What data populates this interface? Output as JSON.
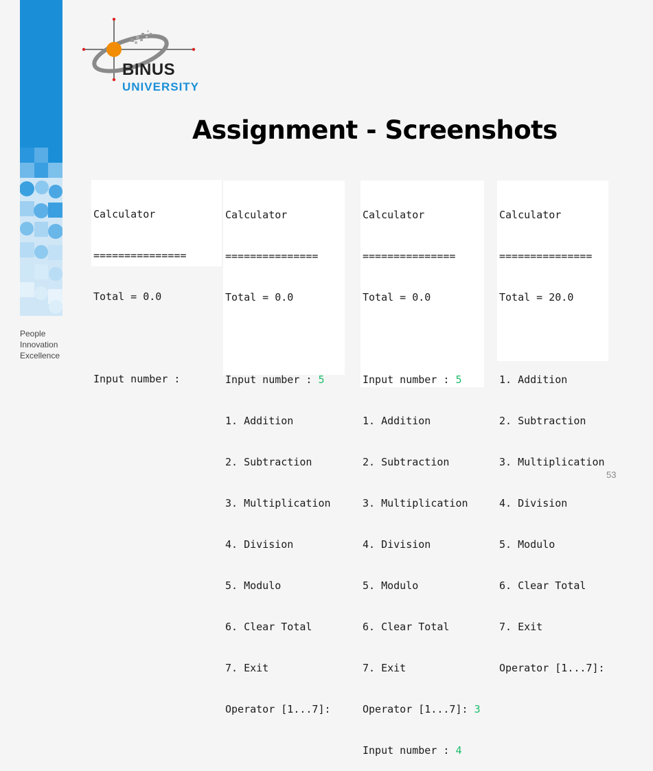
{
  "tagline": [
    "People",
    "Innovation",
    "Excellence"
  ],
  "logo": {
    "name": "BINUS",
    "subtitle": "UNIVERSITY"
  },
  "title": "Assignment - Screenshots",
  "page_number": "53",
  "colors": {
    "brand_blue": "#1a8fd8",
    "logo_orange": "#f28c00",
    "number_green": "#1bbd6a"
  },
  "panel1": {
    "header": "Calculator",
    "rule": "===============",
    "total": "Total = 0.0",
    "prompt": "Input number :"
  },
  "panel2": {
    "header": "Calculator",
    "rule": "===============",
    "total": "Total = 0.0",
    "prompt": "Input number :",
    "input": "5",
    "menu": [
      "1. Addition",
      "2. Subtraction",
      "3. Multiplication",
      "4. Division",
      "5. Modulo",
      "6. Clear Total",
      "7. Exit"
    ],
    "operator_prompt": "Operator [1...7]:"
  },
  "panel3": {
    "header": "Calculator",
    "rule": "===============",
    "total": "Total = 0.0",
    "prompt": "Input number :",
    "input": "5",
    "menu": [
      "1. Addition",
      "2. Subtraction",
      "3. Multiplication",
      "4. Division",
      "5. Modulo",
      "6. Clear Total",
      "7. Exit"
    ],
    "operator_prompt": "Operator [1...7]:",
    "operator": "3",
    "prompt2": "Input number :",
    "input2": "4"
  },
  "panel4": {
    "header": "Calculator",
    "rule": "===============",
    "total": "Total = 20.0",
    "menu": [
      "1. Addition",
      "2. Subtraction",
      "3. Multiplication",
      "4. Division",
      "5. Modulo",
      "6. Clear Total",
      "7. Exit"
    ],
    "operator_prompt": "Operator [1...7]:"
  }
}
